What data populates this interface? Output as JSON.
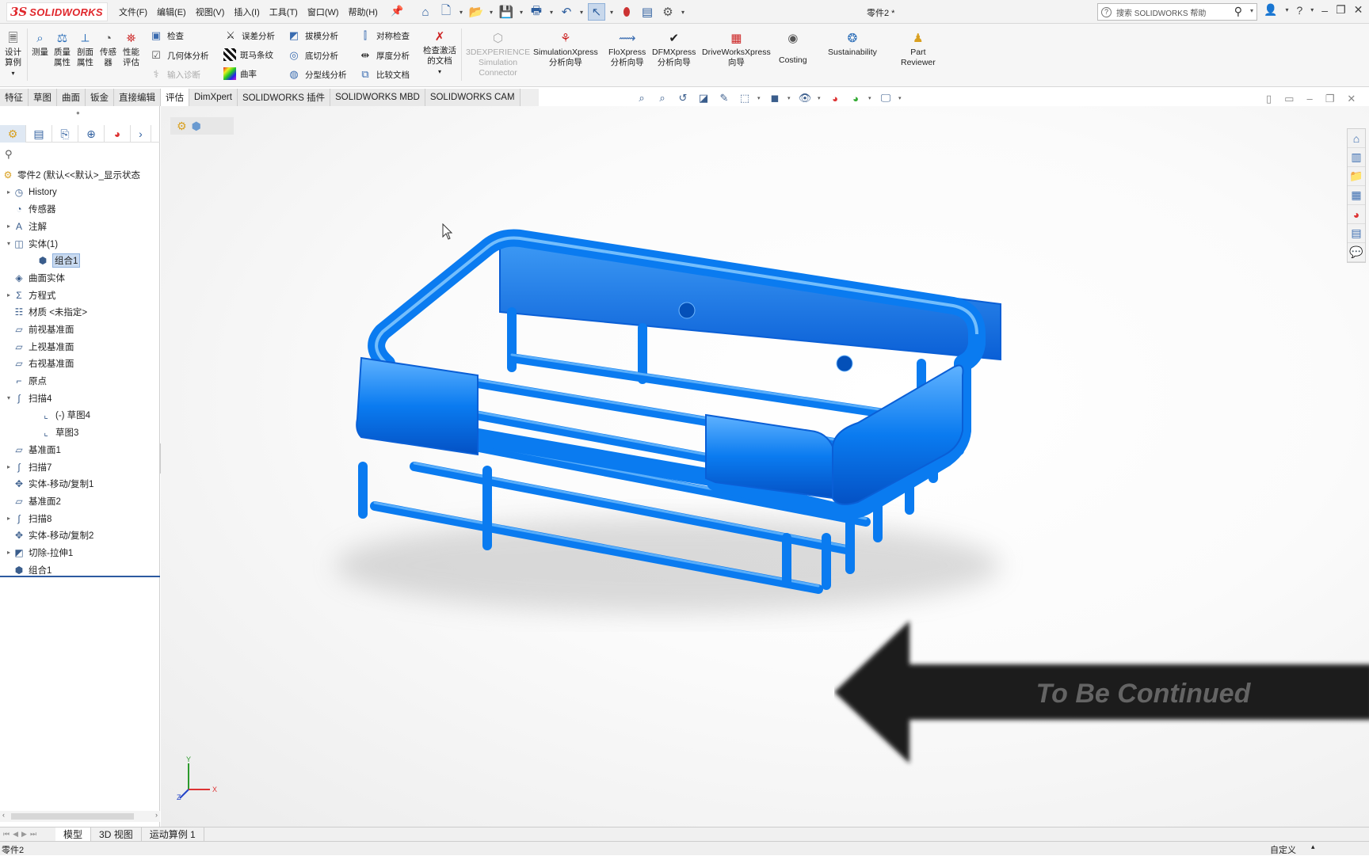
{
  "app": {
    "logo_ds": "3S",
    "logo_text": "SOLIDWORKS",
    "doc_title": "零件2 *"
  },
  "menu": [
    "文件(F)",
    "编辑(E)",
    "视图(V)",
    "插入(I)",
    "工具(T)",
    "窗口(W)",
    "帮助(H)"
  ],
  "search": {
    "placeholder": "搜索 SOLIDWORKS 帮助"
  },
  "toolbar_left": {
    "design_study": "设计\n算例",
    "measure": "测量",
    "mass_props": "质量\n属性",
    "section_props": "剖面\n属性",
    "sensor": "传感\n器",
    "perf_eval": "性能\n评估"
  },
  "toolbar_rows": {
    "check": "检查",
    "geometry_analysis": "几何体分析",
    "import_diag": "输入诊断",
    "deviation": "误差分析",
    "zebra": "斑马条纹",
    "curvature": "曲率",
    "draft": "拔模分析",
    "undercut": "底切分析",
    "parting": "分型线分析",
    "symmetry": "对称检查",
    "thickness": "厚度分析",
    "compare": "比较文档",
    "check_active": "检查激活\n的文档"
  },
  "toolbar_right": {
    "experience": "3DEXPERIENCE\nSimulation\nConnector",
    "simxpress": "SimulationXpress\n分析向导",
    "floxpress": "FloXpress\n分析向导",
    "dfmxpress": "DFMXpress\n分析向导",
    "driveworks": "DriveWorksXpress\n向导",
    "costing": "Costing",
    "sustainability": "Sustainability",
    "part_reviewer": "Part\nReviewer"
  },
  "tabs": [
    "特征",
    "草图",
    "曲面",
    "钣金",
    "直接编辑",
    "评估",
    "DimXpert",
    "SOLIDWORKS 插件",
    "SOLIDWORKS MBD",
    "SOLIDWORKS CAM"
  ],
  "active_tab": "评估",
  "tree": {
    "root": "零件2 (默认<<默认>_显示状态",
    "nodes": [
      {
        "label": "History"
      },
      {
        "label": "传感器"
      },
      {
        "label": "注解"
      },
      {
        "label": "实体(1)"
      },
      {
        "label": "组合1"
      },
      {
        "label": "曲面实体"
      },
      {
        "label": "方程式"
      },
      {
        "label": "材质 <未指定>"
      },
      {
        "label": "前视基准面"
      },
      {
        "label": "上视基准面"
      },
      {
        "label": "右视基准面"
      },
      {
        "label": "原点"
      },
      {
        "label": "扫描4"
      },
      {
        "label": "(-) 草图4"
      },
      {
        "label": "草图3"
      },
      {
        "label": "基准面1"
      },
      {
        "label": "扫描7"
      },
      {
        "label": "实体-移动/复制1"
      },
      {
        "label": "基准面2"
      },
      {
        "label": "扫描8"
      },
      {
        "label": "实体-移动/复制2"
      },
      {
        "label": "切除-拉伸1"
      },
      {
        "label": "组合1"
      }
    ]
  },
  "banner_text": "To Be Continued",
  "triad": {
    "x": "X",
    "y": "Y",
    "z": "Z"
  },
  "bottom_tabs": [
    "模型",
    "3D 视图",
    "运动算例 1"
  ],
  "status": {
    "left": "零件2",
    "right": "自定义",
    "right_dd": "▴"
  },
  "colors": {
    "model_blue": "#0a7bf0",
    "accent_red": "#e0262b"
  }
}
